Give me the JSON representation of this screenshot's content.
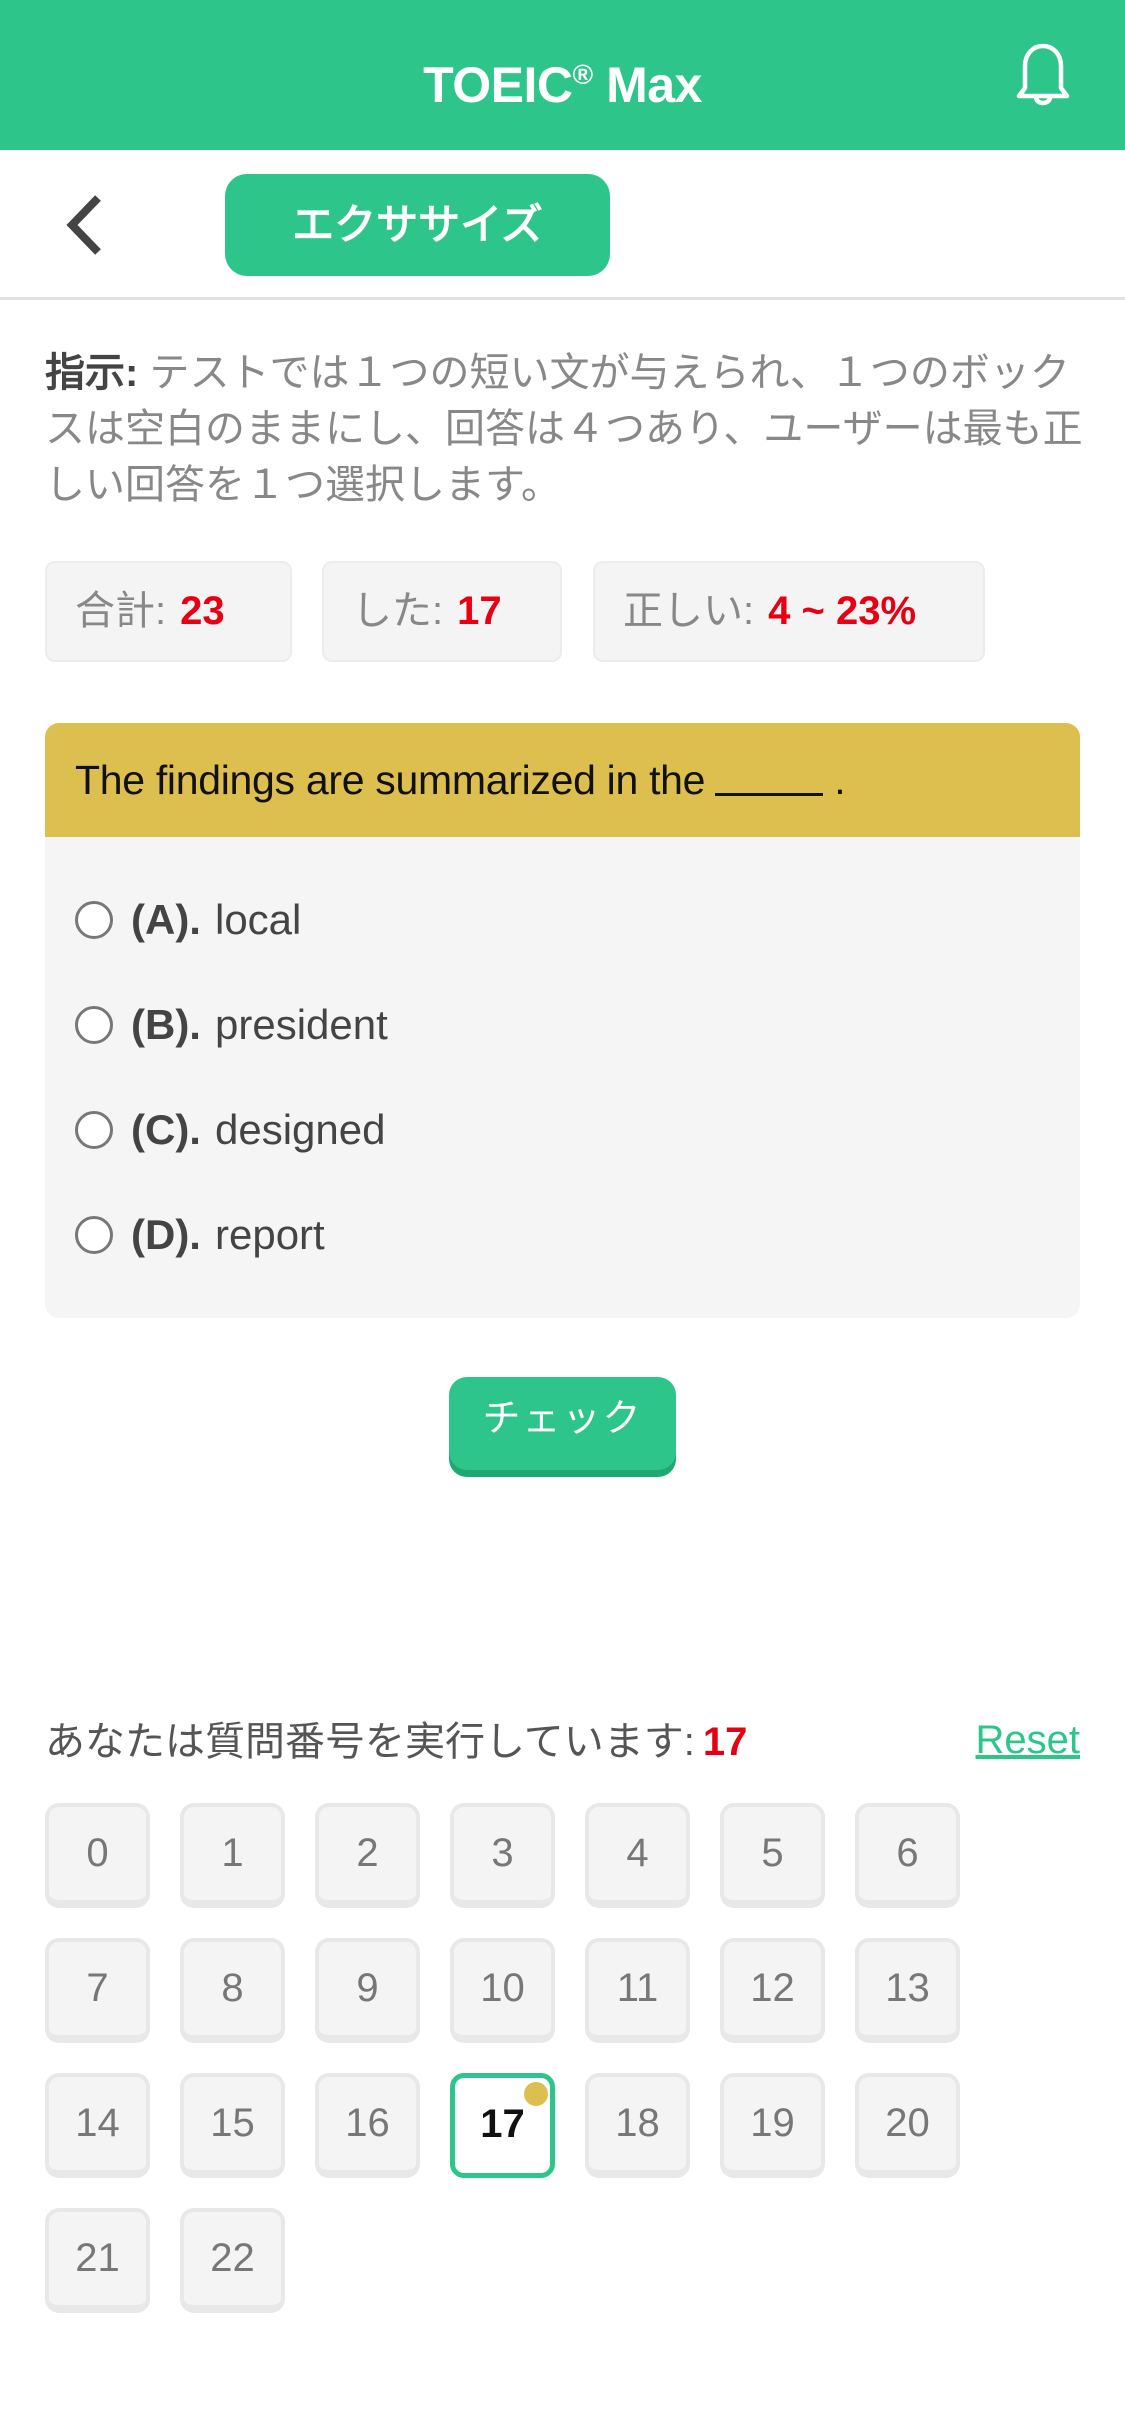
{
  "colors": {
    "brand_green": "#2DC58A",
    "question_yellow": "#DCBF4F",
    "stat_red": "#e60012"
  },
  "appbar": {
    "title": "TOEIC",
    "title_sup": "®",
    "title_suffix": " Max",
    "notification_icon": "bell-icon"
  },
  "subbar": {
    "back_icon": "chevron-left-icon",
    "section_label": "エクササイズ"
  },
  "instructions": {
    "label": "指示:",
    "text": " テストでは１つの短い文が与えられ、１つのボックスは空白のままにし、回答は４つあり、ユーザーは最も正しい回答を１つ選択します。"
  },
  "stats": {
    "total_label": "合計:",
    "total_value": "23",
    "done_label": "した:",
    "done_value": "17",
    "correct_label": "正しい:",
    "correct_value": "4 ~ 23%"
  },
  "question": {
    "text": "The findings are summarized in the",
    "end": " .",
    "options": [
      {
        "letter": "(A).",
        "text": "local"
      },
      {
        "letter": "(B).",
        "text": "president"
      },
      {
        "letter": "(C).",
        "text": "designed"
      },
      {
        "letter": "(D).",
        "text": "report"
      }
    ]
  },
  "check_button": "チェック",
  "progress": {
    "label": "あなたは質問番号を実行しています:",
    "current": "17",
    "reset_label": "Reset"
  },
  "question_numbers": [
    "0",
    "1",
    "2",
    "3",
    "4",
    "5",
    "6",
    "7",
    "8",
    "9",
    "10",
    "11",
    "12",
    "13",
    "14",
    "15",
    "16",
    "17",
    "18",
    "19",
    "20",
    "21",
    "22"
  ],
  "active_question": "17"
}
